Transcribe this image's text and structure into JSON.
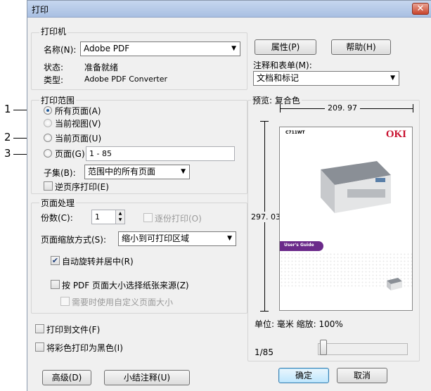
{
  "window": {
    "title": "打印",
    "close_glyph": "✕"
  },
  "printer": {
    "group_title": "打印机",
    "name_label": "名称(N):",
    "name_value": "Adobe PDF",
    "status_label": "状态:",
    "status_value": "准备就绪",
    "type_label": "类型:",
    "type_value": "Adobe PDF Converter",
    "properties_button": "属性(P)",
    "help_button": "帮助(H)",
    "comments_label": "注释和表单(M):",
    "comments_value": "文档和标记"
  },
  "range": {
    "group_title": "打印范围",
    "all_pages": "所有页面(A)",
    "current_view": "当前视图(V)",
    "current_page": "当前页面(U)",
    "pages": "页面(G)",
    "pages_value": "1 - 85",
    "subset_label": "子集(B):",
    "subset_value": "范围中的所有页面",
    "reverse": "逆页序打印(E)"
  },
  "handling": {
    "group_title": "页面处理",
    "copies_label": "份数(C):",
    "copies_value": "1",
    "collate": "逐份打印(O)",
    "scaling_label": "页面缩放方式(S):",
    "scaling_value": "缩小到可打印区域",
    "auto_rotate": "自动旋转并居中(R)",
    "choose_paper": "按 PDF 页面大小选择纸张来源(Z)",
    "custom_size": "需要时使用自定义页面大小"
  },
  "options": {
    "print_to_file": "打印到文件(F)",
    "print_black": "将彩色打印为黑色(I)"
  },
  "preview": {
    "label": "预览: 复合色",
    "width": "209. 97",
    "height": "297. 03",
    "units": "单位: 毫米 缩放: 100%",
    "page_indicator": "1/85",
    "page_position": 0.0,
    "model": "C711WT",
    "brand": "OKI",
    "guide": "User's Guide"
  },
  "buttons": {
    "advanced": "高级(D)",
    "summarize": "小结注释(U)",
    "ok": "确定",
    "cancel": "取消"
  },
  "callouts": [
    "1",
    "2",
    "3"
  ]
}
